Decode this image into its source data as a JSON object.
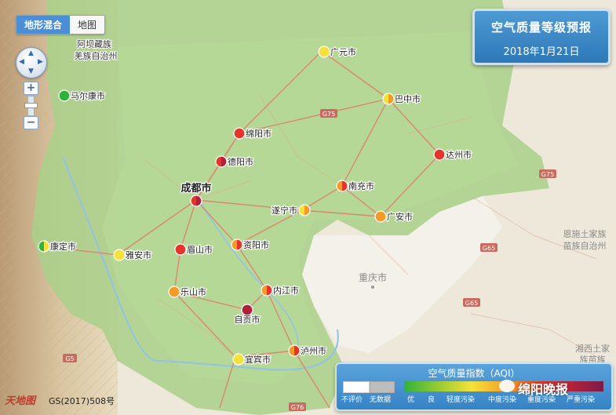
{
  "map_type": {
    "terrain_label": "地形混合",
    "map_label": "地图",
    "active": "terrain"
  },
  "title": {
    "main": "空气质量等级预报",
    "date": "2018年1月21日"
  },
  "region_labels": {
    "aba": [
      "阿坝藏族",
      "羌族自治州"
    ],
    "enshi": [
      "恩施土家族",
      "苗族自治州"
    ],
    "xiangxi": [
      "湘西土家",
      "族苗族"
    ],
    "chongqing": "重庆市"
  },
  "cities": [
    {
      "name": "广元市",
      "level": "良",
      "color": "#f4e23a",
      "color2": "#f4e23a",
      "big": false
    },
    {
      "name": "马尔康市",
      "level": "优",
      "color": "#2fb33a",
      "color2": "#2fb33a",
      "big": false
    },
    {
      "name": "巴中市",
      "level": "良/轻度污染",
      "color": "#f4e23a",
      "color2": "#f49b27",
      "big": false
    },
    {
      "name": "绵阳市",
      "level": "中度污染",
      "color": "#e5342a",
      "color2": "#e5342a",
      "big": false
    },
    {
      "name": "德阳市",
      "level": "中度/重度污染",
      "color": "#e5342a",
      "color2": "#b0203a",
      "big": false
    },
    {
      "name": "达州市",
      "level": "中度污染",
      "color": "#e5342a",
      "color2": "#e5342a",
      "big": false
    },
    {
      "name": "成都市",
      "level": "中度/重度污染",
      "color": "#e5342a",
      "color2": "#b0203a",
      "big": true
    },
    {
      "name": "南充市",
      "level": "轻度/中度污染",
      "color": "#f49b27",
      "color2": "#e5342a",
      "big": false
    },
    {
      "name": "遂宁市",
      "level": "良/轻度污染",
      "color": "#f4e23a",
      "color2": "#f49b27",
      "big": false
    },
    {
      "name": "广安市",
      "level": "轻度污染",
      "color": "#f49b27",
      "color2": "#f49b27",
      "big": false
    },
    {
      "name": "康定市",
      "level": "优/良",
      "color": "#2fb33a",
      "color2": "#f4e23a",
      "big": false
    },
    {
      "name": "雅安市",
      "level": "良",
      "color": "#f4e23a",
      "color2": "#f4e23a",
      "big": false
    },
    {
      "name": "眉山市",
      "level": "中度污染",
      "color": "#e5342a",
      "color2": "#e5342a",
      "big": false
    },
    {
      "name": "资阳市",
      "level": "轻度/中度污染",
      "color": "#f49b27",
      "color2": "#e5342a",
      "big": false
    },
    {
      "name": "乐山市",
      "level": "轻度污染",
      "color": "#f49b27",
      "color2": "#f49b27",
      "big": false
    },
    {
      "name": "内江市",
      "level": "轻度/中度污染",
      "color": "#f49b27",
      "color2": "#e5342a",
      "big": false
    },
    {
      "name": "自贡市",
      "level": "重度污染",
      "color": "#b0203a",
      "color2": "#b0203a",
      "big": false
    },
    {
      "name": "宜宾市",
      "level": "良",
      "color": "#f4e23a",
      "color2": "#f4e23a",
      "big": false
    },
    {
      "name": "泸州市",
      "level": "轻度/中度污染",
      "color": "#f49b27",
      "color2": "#e5342a",
      "big": false
    }
  ],
  "highway_labels": [
    "G75",
    "G75",
    "G65",
    "G5",
    "G65",
    "G76"
  ],
  "legend": {
    "title": "空气质量指数（AQI）",
    "labels": [
      "不评价",
      "无数据",
      "优",
      "良",
      "轻度污染",
      "中度污染",
      "重度污染",
      "严重污染"
    ]
  },
  "copyright": "GS(2017)508号",
  "logo": "天地图",
  "watermark": "绵阳晚报"
}
